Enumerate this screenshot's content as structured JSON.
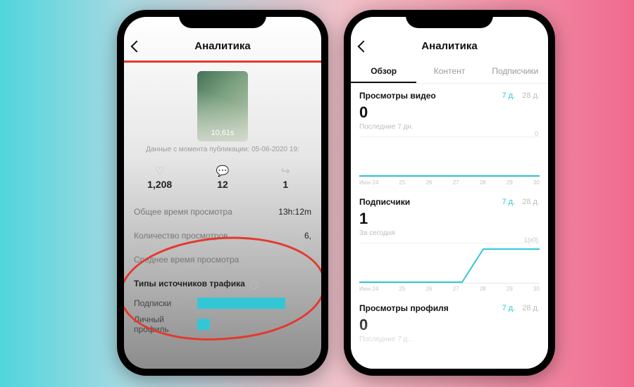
{
  "left": {
    "title": "Аналитика",
    "thumb_duration": "10,61s",
    "meta": "Данные с момента публикации: 05-06-2020 19:",
    "stats": {
      "likes": "1,208",
      "comments": "12",
      "shares": "1"
    },
    "rows": {
      "watch_time_label": "Общее время просмотра",
      "watch_time_value": "13h:12m",
      "views_label": "Количество просмотров",
      "views_value": "6,",
      "avg_watch_label": "Среднее время просмотра"
    },
    "traffic": {
      "heading": "Типы источников трафика",
      "bars": [
        {
          "label": "Подписки",
          "pct": 72
        },
        {
          "label": "Личный профиль",
          "pct": 10
        }
      ]
    }
  },
  "right": {
    "title": "Аналитика",
    "tabs": [
      "Обзор",
      "Контент",
      "Подписчики"
    ],
    "active_tab": 0,
    "ranges": {
      "d7": "7 д.",
      "d28": "28 д."
    },
    "xticks": [
      "Июн 24",
      "25",
      "26",
      "27",
      "28",
      "29",
      "30"
    ],
    "video_views": {
      "label": "Просмотры видео",
      "value": "0",
      "sub": "Последние 7 дн.",
      "ymax": "0"
    },
    "followers": {
      "label": "Подписчики",
      "value": "1",
      "sub": "За сегодня",
      "ymax": "1(к0)"
    },
    "profile_views": {
      "label": "Просмотры профиля",
      "value": "0",
      "sub": "Последние 7 д…"
    }
  },
  "chart_data": {
    "type": "line",
    "series": [
      {
        "name": "Просмотры видео",
        "x": [
          "Июн 24",
          "25",
          "26",
          "27",
          "28",
          "29",
          "30"
        ],
        "values": [
          0,
          0,
          0,
          0,
          0,
          0,
          0
        ]
      },
      {
        "name": "Подписчики",
        "x": [
          "Июн 24",
          "25",
          "26",
          "27",
          "28",
          "29",
          "30"
        ],
        "values": [
          0,
          0,
          0,
          0,
          1,
          1,
          1
        ]
      }
    ],
    "traffic_sources_bar": {
      "type": "bar",
      "categories": [
        "Подписки",
        "Личный профиль"
      ],
      "values": [
        72,
        10
      ],
      "title": "Типы источников трафика"
    }
  }
}
